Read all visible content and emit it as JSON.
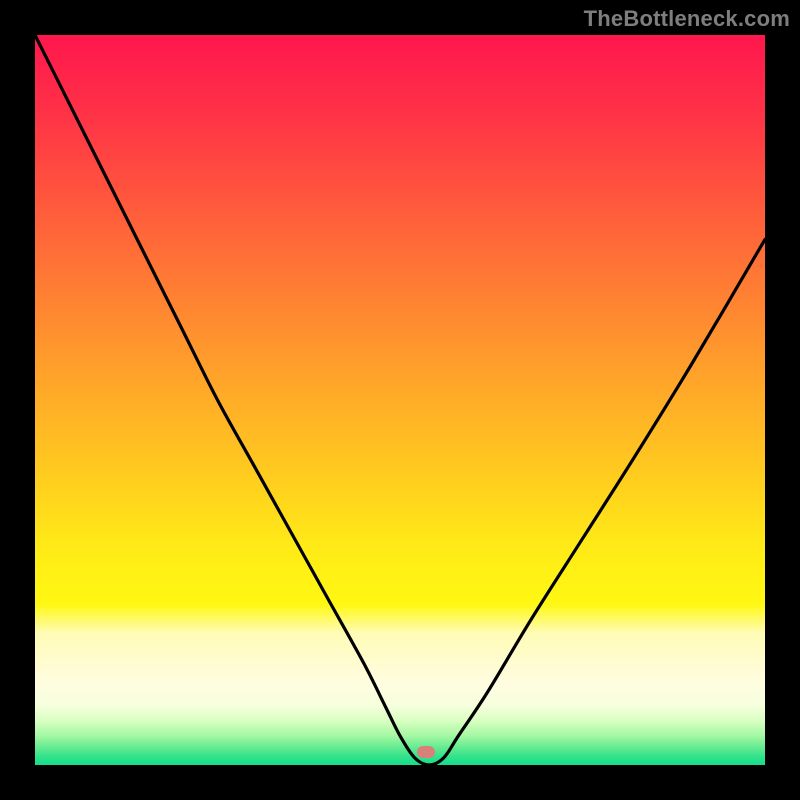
{
  "watermark": "TheBottleneck.com",
  "marker": {
    "x_frac": 0.535,
    "y_frac": 0.982,
    "color": "#d9807a"
  },
  "gradient": {
    "stops": [
      {
        "pos": 0.0,
        "color": "#ff174d"
      },
      {
        "pos": 0.1,
        "color": "#ff3047"
      },
      {
        "pos": 0.2,
        "color": "#ff4f3f"
      },
      {
        "pos": 0.3,
        "color": "#ff6f37"
      },
      {
        "pos": 0.4,
        "color": "#ff8e2f"
      },
      {
        "pos": 0.5,
        "color": "#ffad27"
      },
      {
        "pos": 0.6,
        "color": "#ffcb1f"
      },
      {
        "pos": 0.7,
        "color": "#ffea17"
      },
      {
        "pos": 0.78,
        "color": "#fff812"
      },
      {
        "pos": 0.82,
        "color": "#fffcb7"
      },
      {
        "pos": 0.86,
        "color": "#fffcd0"
      },
      {
        "pos": 0.89,
        "color": "#fffde0"
      },
      {
        "pos": 0.92,
        "color": "#f5ffdc"
      },
      {
        "pos": 0.94,
        "color": "#d8ffc2"
      },
      {
        "pos": 0.96,
        "color": "#a6f8a4"
      },
      {
        "pos": 0.975,
        "color": "#6bec93"
      },
      {
        "pos": 0.99,
        "color": "#2fe28a"
      },
      {
        "pos": 1.0,
        "color": "#18dd8d"
      }
    ],
    "rows": 730
  },
  "chart_data": {
    "type": "line",
    "title": "",
    "xlabel": "",
    "ylabel": "",
    "ylim": [
      0,
      100
    ],
    "xlim": [
      0,
      100
    ],
    "x": [
      0,
      5,
      10,
      15,
      20,
      25,
      30,
      35,
      40,
      45,
      48,
      50,
      52,
      54,
      56,
      58,
      62,
      68,
      75,
      82,
      90,
      100
    ],
    "y": [
      100,
      90,
      80,
      70,
      60,
      50,
      41,
      32,
      23,
      14,
      8,
      4,
      1,
      0,
      1,
      4,
      10,
      20,
      31,
      42,
      55,
      72
    ],
    "annotations": [
      {
        "text": "TheBottleneck.com",
        "role": "watermark"
      }
    ],
    "optimum_x": 53.5
  }
}
